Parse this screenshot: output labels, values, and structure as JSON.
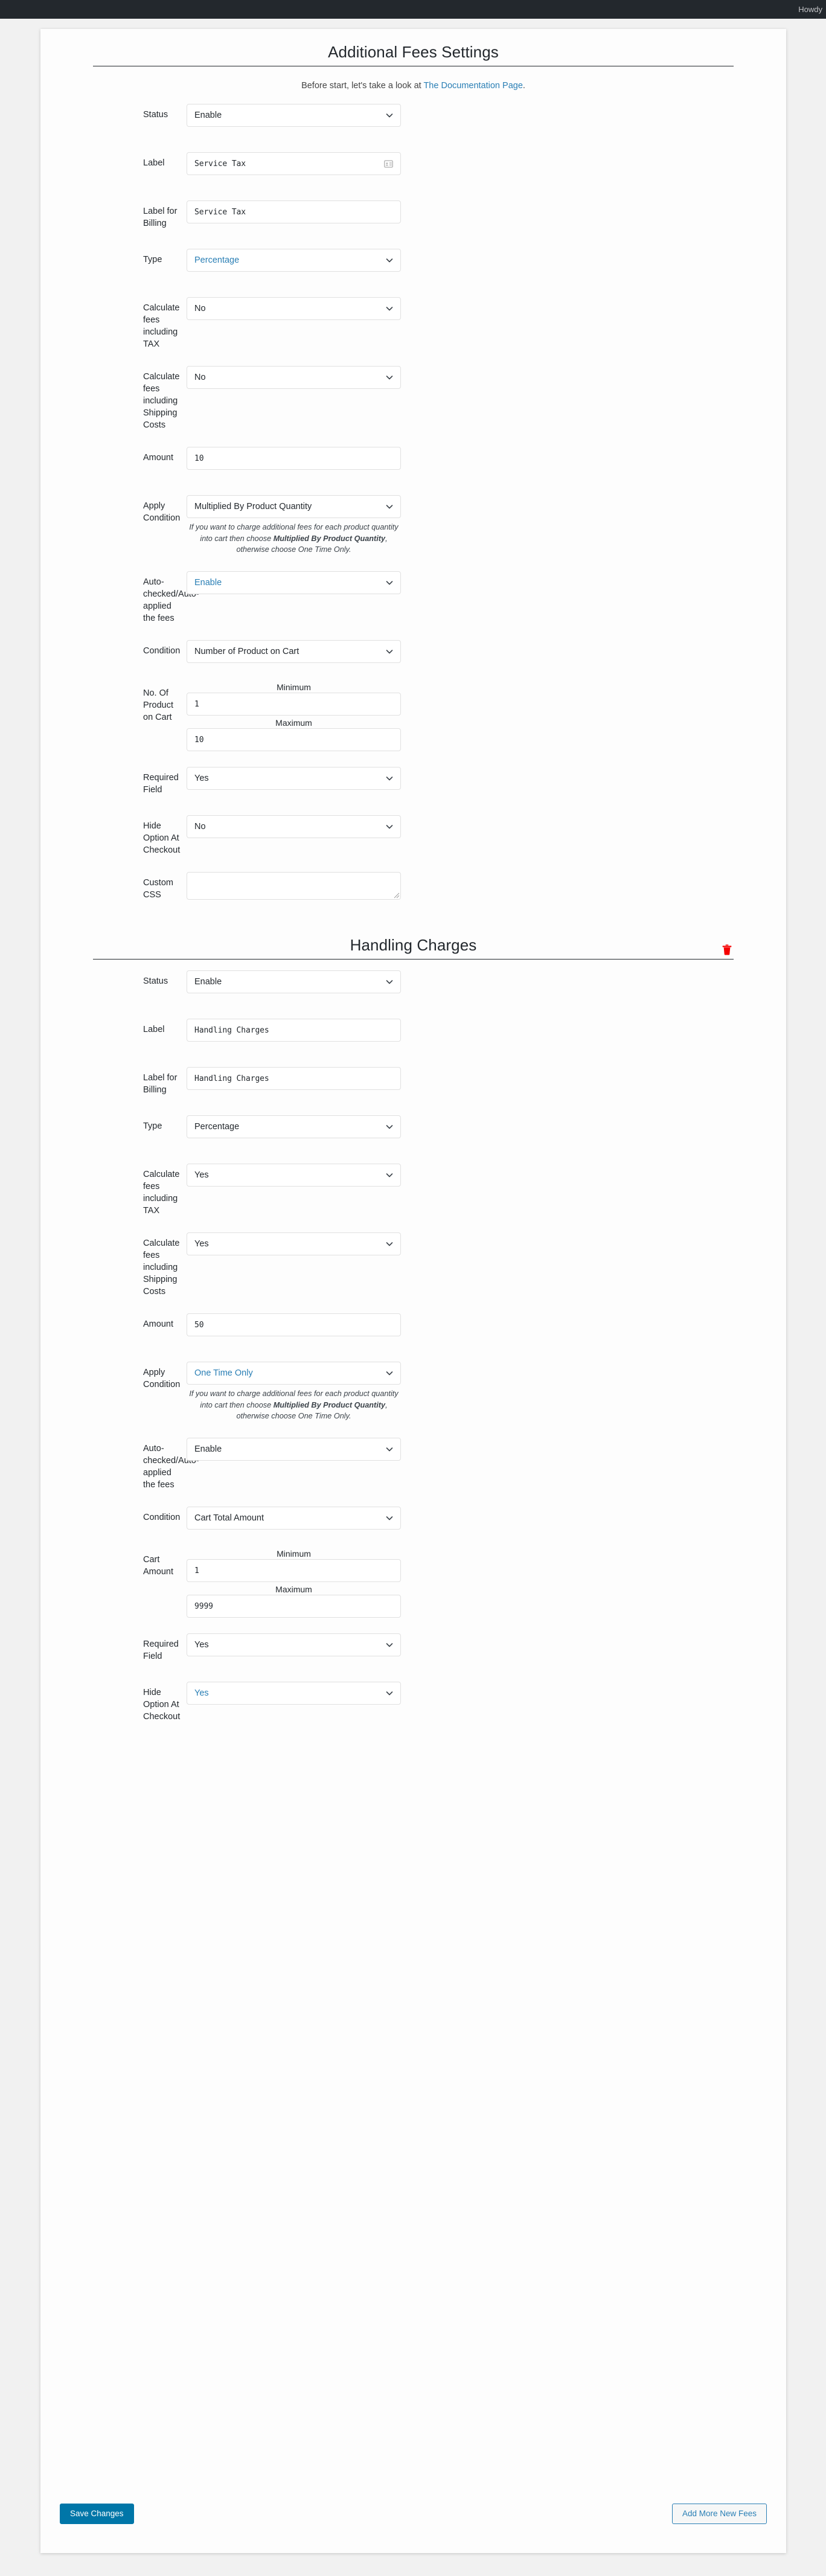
{
  "adminbar": {
    "howdy": "Howdy"
  },
  "page": {
    "title": "Additional Fees Settings",
    "intro_prefix": "Before start, let's take a look at ",
    "intro_link": "The Documentation Page",
    "intro_suffix": "."
  },
  "icons": {
    "caret": "chevron-down-icon",
    "address_card": "address-card-icon",
    "trash": "trash-icon"
  },
  "colors": {
    "accent_blue": "#2a7fb5",
    "primary_button": "#0076a8",
    "delete_red": "#f50000",
    "adminbar": "#23282d"
  },
  "labels": {
    "status": "Status",
    "label": "Label",
    "label_for_billing": "Label for Billing",
    "type": "Type",
    "calc_tax": "Calculate fees including TAX",
    "calc_shipping": "Calculate fees including Shipping Costs",
    "amount": "Amount",
    "apply_condition": "Apply Condition",
    "auto_checked": "Auto-checked/Auto-applied the fees",
    "condition": "Condition",
    "no_of_product": "No. Of Product on Cart",
    "cart_amount": "Cart Amount",
    "required_field": "Required Field",
    "hide_option": "Hide Option At Checkout",
    "custom_css": "Custom CSS",
    "minimum": "Minimum",
    "maximum": "Maximum"
  },
  "hint": {
    "part1": "If you want to charge additional fees for each product quantity into cart then choose ",
    "bold": "Multiplied By Product Quantity",
    "part2": ", otherwise choose One Time Only."
  },
  "sections": [
    {
      "title": "Additional Fees Settings",
      "deletable": false,
      "status": "Enable",
      "label": "Service Tax",
      "label_has_icon": true,
      "label_for_billing": "Service Tax",
      "type": "Percentage",
      "type_blue": true,
      "calc_tax": "No",
      "calc_shipping": "No",
      "amount": "10",
      "apply_condition": "Multiplied By Product Quantity",
      "apply_condition_blue": false,
      "auto_checked": "Enable",
      "auto_checked_blue": true,
      "condition": "Number of Product on Cart",
      "range_label": "No. Of Product on Cart",
      "minimum": "1",
      "maximum": "10",
      "required_field": "Yes",
      "required_field_blue": false,
      "hide_option": "No",
      "hide_option_blue": false,
      "custom_css": "",
      "has_custom_css": true
    },
    {
      "title": "Handling Charges",
      "deletable": true,
      "status": "Enable",
      "label": "Handling Charges",
      "label_has_icon": false,
      "label_for_billing": "Handling Charges",
      "type": "Percentage",
      "type_blue": false,
      "calc_tax": "Yes",
      "calc_shipping": "Yes",
      "amount": "50",
      "apply_condition": "One Time Only",
      "apply_condition_blue": true,
      "auto_checked": "Enable",
      "auto_checked_blue": false,
      "condition": "Cart Total Amount",
      "range_label": "Cart Amount",
      "minimum": "1",
      "maximum": "9999",
      "required_field": "Yes",
      "required_field_blue": false,
      "hide_option": "Yes",
      "hide_option_blue": true,
      "custom_css": "",
      "has_custom_css": false
    }
  ],
  "footer": {
    "save_label": "Save Changes",
    "add_label": "Add More New Fees"
  }
}
